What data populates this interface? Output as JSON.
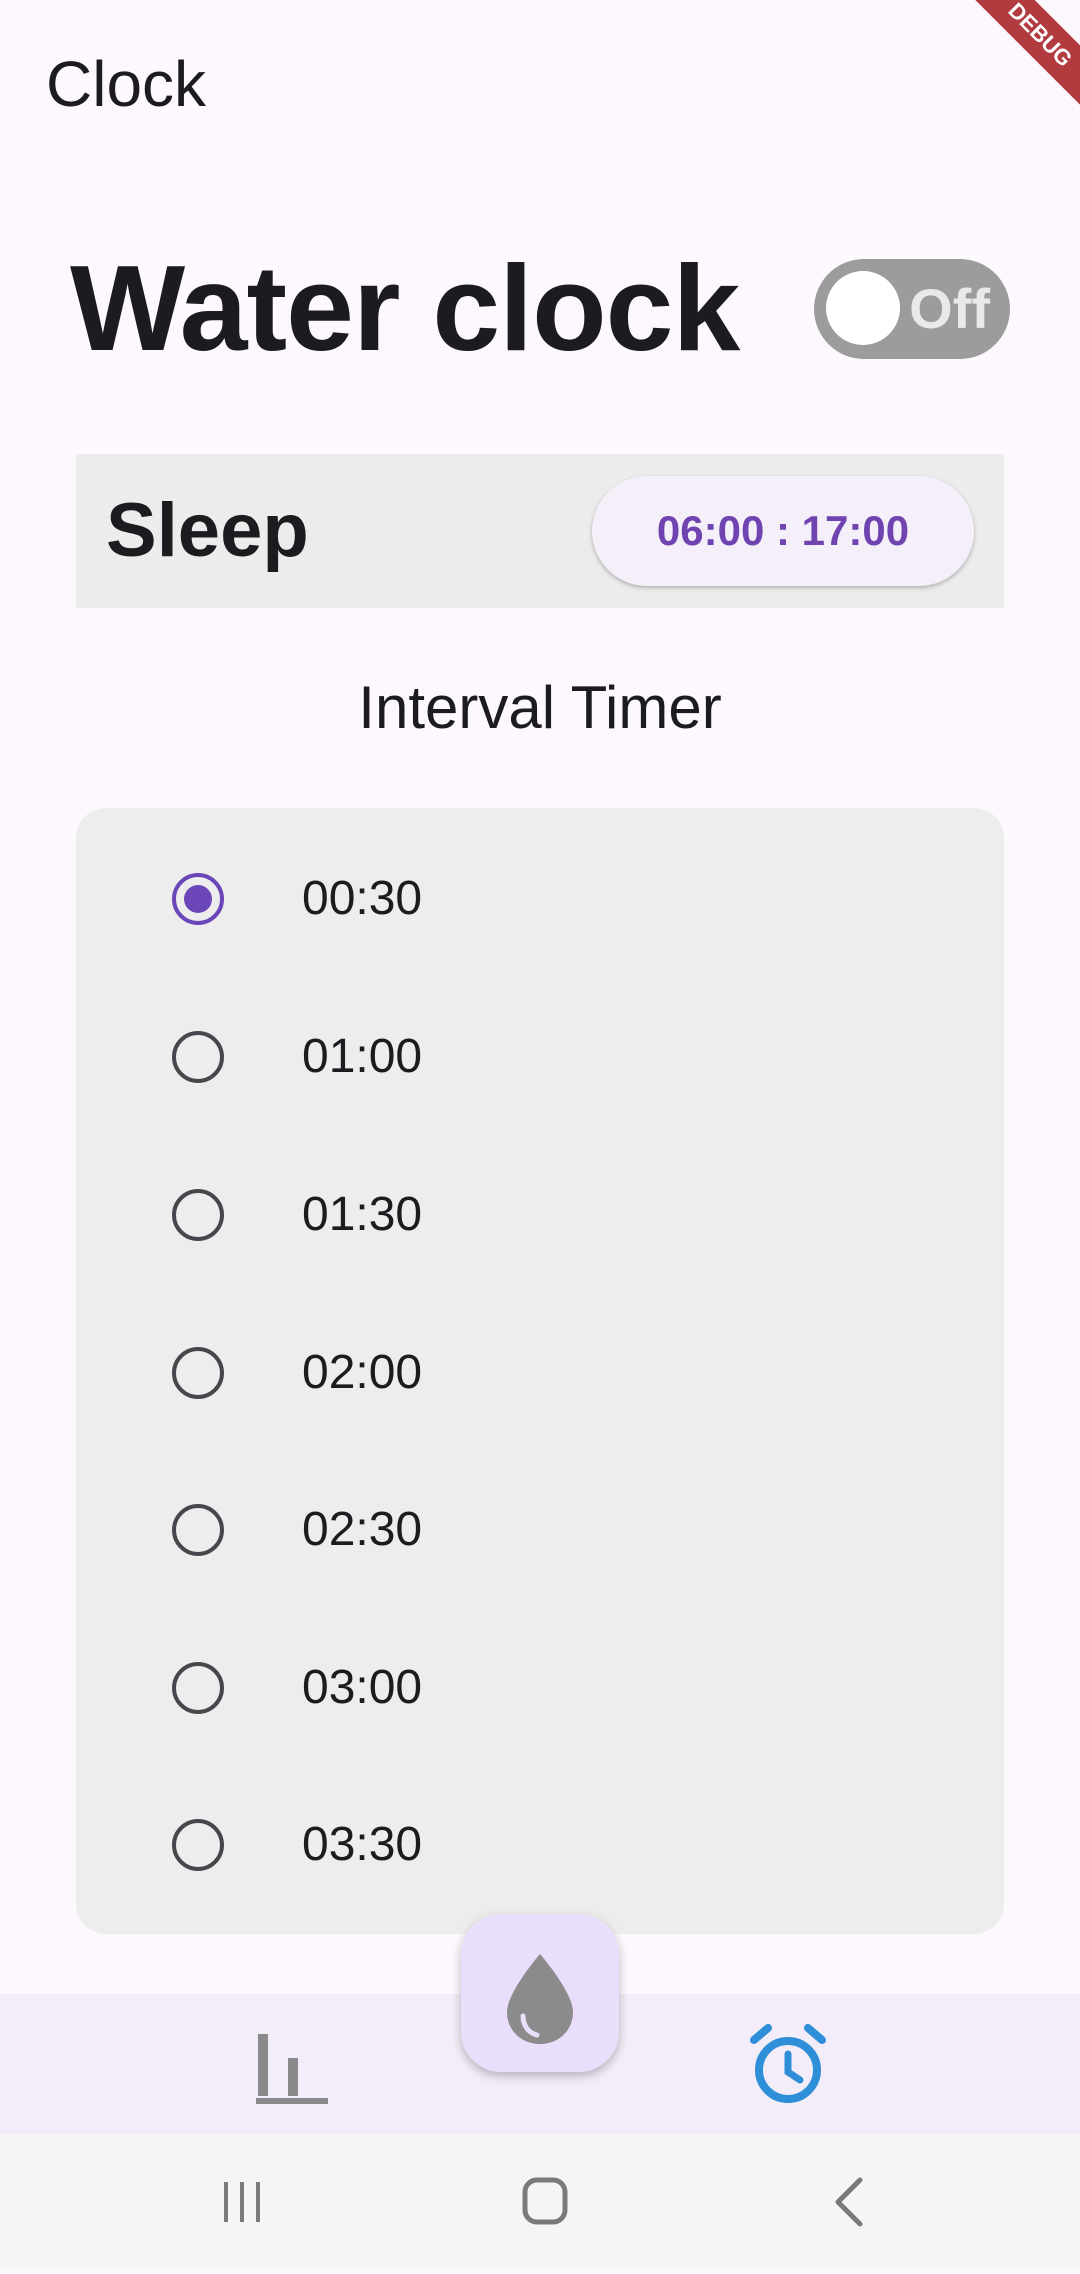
{
  "app_bar": {
    "title": "Clock",
    "debug_banner": "DEBUG"
  },
  "water_clock": {
    "title": "Water clock",
    "toggle_label": "Off",
    "enabled": false
  },
  "sleep": {
    "label": "Sleep",
    "time_range": "06:00 : 17:00"
  },
  "interval_timer": {
    "title": "Interval Timer",
    "selected": "00:30",
    "options": [
      {
        "label": "00:30",
        "selected": true
      },
      {
        "label": "01:00",
        "selected": false
      },
      {
        "label": "01:30",
        "selected": false
      },
      {
        "label": "02:00",
        "selected": false
      },
      {
        "label": "02:30",
        "selected": false
      },
      {
        "label": "03:00",
        "selected": false
      },
      {
        "label": "03:30",
        "selected": false
      }
    ]
  },
  "bottom_nav": {
    "items": [
      {
        "icon": "bar-chart-icon",
        "active": false
      },
      {
        "icon": "water-drop-icon",
        "active": false
      },
      {
        "icon": "alarm-clock-icon",
        "active": true
      }
    ]
  },
  "system_nav": {
    "buttons": [
      "recent-apps-icon",
      "home-icon",
      "back-icon"
    ]
  },
  "colors": {
    "accent": "#6b46b9",
    "active_nav": "#2e8fd8",
    "fab_background": "#e9defc",
    "toggle_off": "#9c9c9c"
  }
}
